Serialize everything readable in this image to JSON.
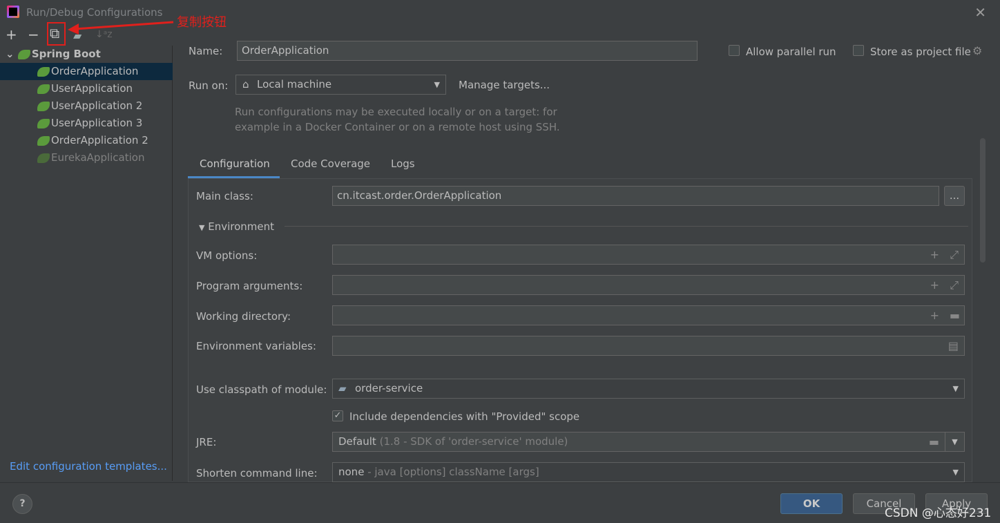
{
  "window": {
    "title": "Run/Debug Configurations"
  },
  "annotation": "复制按钮",
  "toolbar": {
    "add": "+",
    "remove": "−",
    "copy": "⧉",
    "folder": "▰",
    "sort": "↓ᵃz"
  },
  "tree": {
    "group": "Spring Boot",
    "items": [
      {
        "label": "OrderApplication",
        "selected": true,
        "disabled": false
      },
      {
        "label": "UserApplication",
        "selected": false,
        "disabled": false
      },
      {
        "label": "UserApplication 2",
        "selected": false,
        "disabled": false
      },
      {
        "label": "UserApplication 3",
        "selected": false,
        "disabled": false
      },
      {
        "label": "OrderApplication 2",
        "selected": false,
        "disabled": false
      },
      {
        "label": "EurekaApplication",
        "selected": false,
        "disabled": true
      }
    ]
  },
  "edit_templates": "Edit configuration templates...",
  "form": {
    "name_label": "Name:",
    "name_value": "OrderApplication",
    "allow_parallel": "Allow parallel run",
    "store_project": "Store as project file",
    "run_on_label": "Run on:",
    "run_on_value": "Local machine",
    "manage_targets": "Manage targets...",
    "hint1": "Run configurations may be executed locally or on a target: for",
    "hint2": "example in a Docker Container or on a remote host using SSH.",
    "tabs": [
      "Configuration",
      "Code Coverage",
      "Logs"
    ],
    "main_class_label": "Main class:",
    "main_class_value": "cn.itcast.order.OrderApplication",
    "browse": "...",
    "environment": "Environment",
    "vm_label": "VM options:",
    "args_label": "Program arguments:",
    "wd_label": "Working directory:",
    "env_label": "Environment variables:",
    "module_label": "Use classpath of module:",
    "module_value": "order-service",
    "include_deps": "Include dependencies with \"Provided\" scope",
    "include_deps_checked": true,
    "jre_label": "JRE:",
    "jre_value": "Default",
    "jre_detail": "(1.8 - SDK of 'order-service' module)",
    "shorten_label": "Shorten command line:",
    "shorten_value": "none",
    "shorten_detail": "- java [options] className [args]"
  },
  "buttons": {
    "help": "?",
    "ok": "OK",
    "cancel": "Cancel",
    "apply": "Apply"
  },
  "watermark": "CSDN @心态好231"
}
